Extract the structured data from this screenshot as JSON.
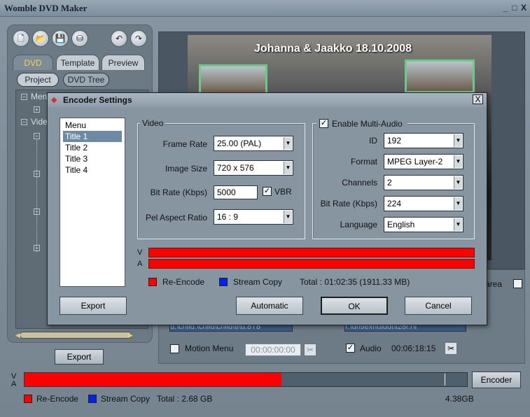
{
  "app": {
    "title": "Womble DVD Maker",
    "minimize": "_",
    "maximize": "□",
    "close": "X"
  },
  "toolbar": {
    "new": "🗋",
    "open": "📂",
    "save": "💾",
    "save_all": "⛁",
    "undo": "↶",
    "redo": "↷"
  },
  "left_panel": {
    "tabs": [
      "DVD",
      "Template",
      "Preview"
    ],
    "active_tab": "DVD",
    "subtabs": [
      "Project",
      "DVD Tree"
    ],
    "tree": {
      "menu_label": "Menu",
      "video_label": "Video"
    },
    "export_label": "Export"
  },
  "preview": {
    "title": "Johanna & Jaakko 18.10.2008"
  },
  "right_panel": {
    "area_label": "area",
    "motion_menu_label": "Motion Menu",
    "motion_menu_time": "00:00:00:00",
    "audio_label": "Audio",
    "audio_checked": true,
    "audio_time": "00:06:18:15",
    "video_file_text": "u:\\child.\\child\\child\\ti\\u.8T8",
    "audio_file_text": "r:\\unsexhuidut\\l28r.r\\l"
  },
  "bottom": {
    "v_label": "V",
    "a_label": "A",
    "progress_fraction": 0.58,
    "capacity_mark_fraction": 0.95,
    "reencode_label": "Re-Encode",
    "stream_copy_label": "Stream Copy",
    "total_text": "Total : 2.68 GB",
    "capacity_text": "4.38GB",
    "encoder_label": "Encoder",
    "reencode_color": "#ff0000",
    "stream_copy_color": "#0022ee"
  },
  "dialog": {
    "title": "Encoder Settings",
    "close": "X",
    "titles": [
      "Menu",
      "Title 1",
      "Title 2",
      "Title 3",
      "Title 4"
    ],
    "selected_title": "Title 1",
    "video": {
      "group_label": "Video",
      "frame_rate_label": "Frame Rate",
      "frame_rate_value": "25.00  (PAL)",
      "image_size_label": "Image Size",
      "image_size_value": "720 x 576",
      "bit_rate_label": "Bit Rate (Kbps)",
      "bit_rate_value": "5000",
      "vbr_label": "VBR",
      "vbr_checked": true,
      "pel_aspect_label": "Pel Aspect Ratio",
      "pel_aspect_value": "16 : 9"
    },
    "audio": {
      "enable_label": "Enable Multi-Audio",
      "enable_checked": true,
      "id_label": "ID",
      "id_value": "192",
      "format_label": "Format",
      "format_value": "MPEG Layer-2",
      "channels_label": "Channels",
      "channels_value": "2",
      "bit_rate_label": "Bit Rate (Kbps)",
      "bit_rate_value": "224",
      "language_label": "Language",
      "language_value": "English"
    },
    "bars": {
      "v_label": "V",
      "a_label": "A"
    },
    "legend": {
      "reencode_label": "Re-Encode",
      "stream_copy_label": "Stream Copy",
      "total_text": "Total : 01:02:35 (1911.33 MB)"
    },
    "buttons": {
      "export": "Export",
      "automatic": "Automatic",
      "ok": "OK",
      "cancel": "Cancel"
    }
  }
}
